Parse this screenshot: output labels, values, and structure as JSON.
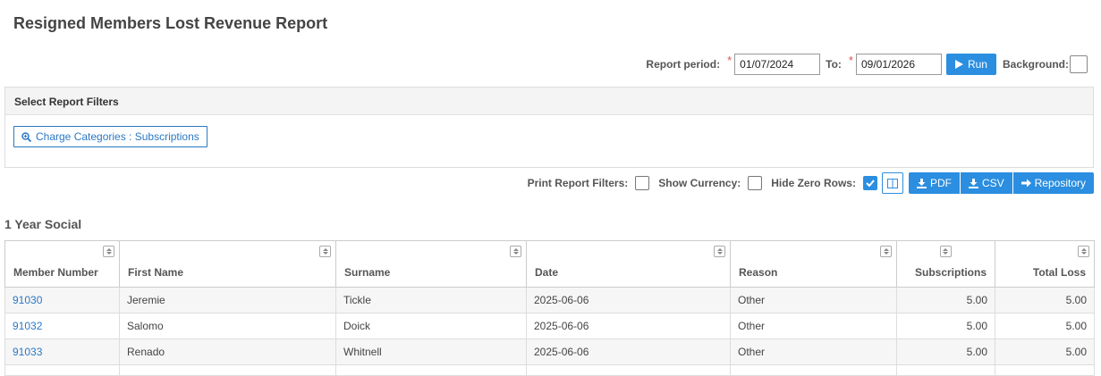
{
  "page": {
    "title": "Resigned Members Lost Revenue Report"
  },
  "period": {
    "label": "Report period:",
    "required_mark": "*",
    "from_value": "01/07/2024",
    "to_label": "To:",
    "to_value": "09/01/2026",
    "run_label": "Run",
    "background_label": "Background:"
  },
  "filters": {
    "heading": "Select Report Filters",
    "button_label": "Charge Categories : Subscriptions"
  },
  "options": {
    "print_filters_label": "Print Report Filters:",
    "print_filters_checked": false,
    "show_currency_label": "Show Currency:",
    "show_currency_checked": false,
    "hide_zero_label": "Hide Zero Rows:",
    "hide_zero_checked": true,
    "pdf_label": "PDF",
    "csv_label": "CSV",
    "repository_label": "Repository"
  },
  "section": {
    "title": "1 Year Social"
  },
  "table": {
    "columns": [
      "Member Number",
      "First Name",
      "Surname",
      "Date",
      "Reason",
      "Subscriptions",
      "Total Loss"
    ],
    "rows": [
      [
        "91030",
        "Jeremie",
        "Tickle",
        "2025-06-06",
        "Other",
        "5.00",
        "5.00"
      ],
      [
        "91032",
        "Salomo",
        "Doick",
        "2025-06-06",
        "Other",
        "5.00",
        "5.00"
      ],
      [
        "91033",
        "Renado",
        "Whitnell",
        "2025-06-06",
        "Other",
        "5.00",
        "5.00"
      ]
    ]
  },
  "colors": {
    "accent": "#2b8ee0",
    "link": "#2b78c5"
  },
  "icons": {
    "run": "play-icon",
    "filter": "zoom-in-icon",
    "columns": "columns-icon",
    "pdf": "download-icon",
    "csv": "download-icon",
    "repository": "arrow-right-icon",
    "sort": "sort-icon"
  }
}
